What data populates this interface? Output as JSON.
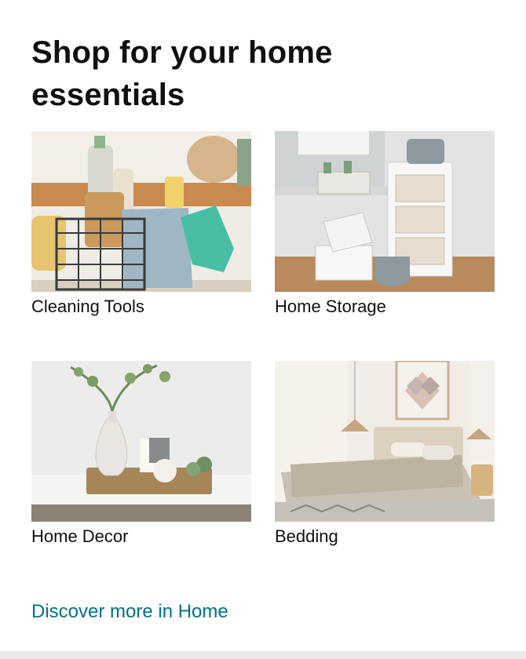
{
  "card": {
    "title": "Shop for your home essentials",
    "tiles": [
      {
        "label": "Cleaning Tools",
        "icon": "cleaning-tools-photo"
      },
      {
        "label": "Home Storage",
        "icon": "home-storage-photo"
      },
      {
        "label": "Home Decor",
        "icon": "home-decor-photo"
      },
      {
        "label": "Bedding",
        "icon": "bedding-photo"
      }
    ],
    "more_link": "Discover more in Home"
  },
  "colors": {
    "link": "#007185",
    "text": "#0f1111",
    "background": "#ffffff"
  }
}
